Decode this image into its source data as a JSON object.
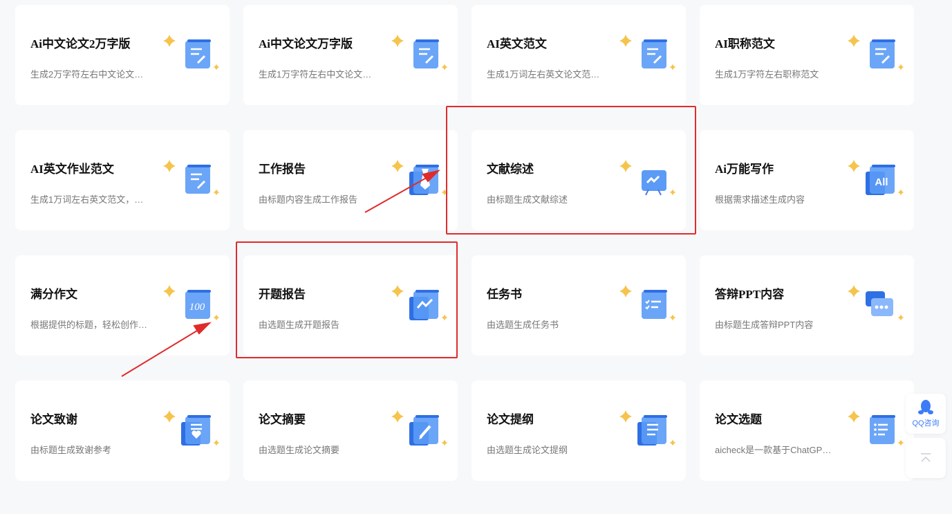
{
  "cards": [
    {
      "title": "Ai中文论文2万字版",
      "desc": "生成2万字符左右中文论文…",
      "icon": "document-edit-icon"
    },
    {
      "title": "Ai中文论文万字版",
      "desc": "生成1万字符左右中文论文…",
      "icon": "document-edit-icon"
    },
    {
      "title": "AI英文范文",
      "desc": "生成1万词左右英文论文范…",
      "icon": "document-edit-icon"
    },
    {
      "title": "AI职称范文",
      "desc": "生成1万字符左右职称范文",
      "icon": "document-edit-icon"
    },
    {
      "title": "AI英文作业范文",
      "desc": "生成1万词左右英文范文，…",
      "icon": "document-edit-icon"
    },
    {
      "title": "工作报告",
      "desc": "由标题内容生成工作报告",
      "icon": "tie-report-icon"
    },
    {
      "title": "文献综述",
      "desc": "由标题生成文献综述",
      "icon": "presentation-board-icon"
    },
    {
      "title": "Ai万能写作",
      "desc": "根据需求描述生成内容",
      "icon": "all-icon"
    },
    {
      "title": "满分作文",
      "desc": "根据提供的标题，轻松创作…",
      "icon": "score-100-icon"
    },
    {
      "title": "开题报告",
      "desc": "由选题生成开题报告",
      "icon": "line-chart-icon"
    },
    {
      "title": "任务书",
      "desc": "由选题生成任务书",
      "icon": "checklist-icon"
    },
    {
      "title": "答辩PPT内容",
      "desc": "由标题生成答辩PPT内容",
      "icon": "chat-bubble-icon"
    },
    {
      "title": "论文致谢",
      "desc": "由标题生成致谢参考",
      "icon": "heart-document-icon"
    },
    {
      "title": "论文摘要",
      "desc": "由选题生成论文摘要",
      "icon": "pencil-note-icon"
    },
    {
      "title": "论文提纲",
      "desc": "由选题生成论文提纲",
      "icon": "outline-document-icon"
    },
    {
      "title": "论文选题",
      "desc": "aicheck是一款基于ChatGP…",
      "icon": "list-document-icon"
    }
  ],
  "float": {
    "qq_label": "QQ咨询",
    "qq_icon": "qq-penguin-icon",
    "top_icon": "back-to-top-icon"
  },
  "colors": {
    "highlight": "#e02b2b",
    "icon_blue": "#5b9bf6",
    "sparkle": "#f6c34c"
  }
}
